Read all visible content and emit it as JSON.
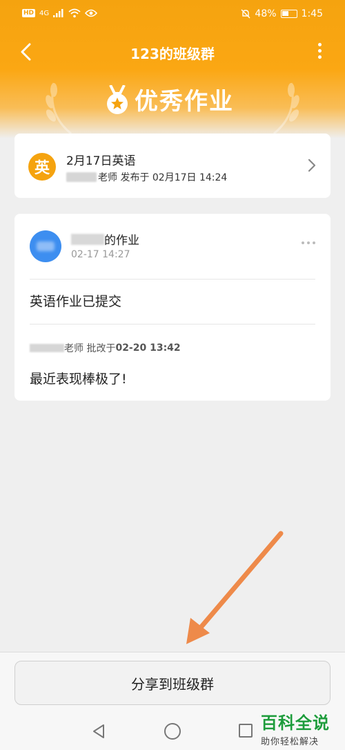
{
  "status_bar": {
    "hd_label": "HD",
    "network_label": "4G",
    "battery_text": "48%",
    "time": "1:45"
  },
  "nav": {
    "title": "123的班级群"
  },
  "banner": {
    "title": "优秀作业"
  },
  "homework_card": {
    "subject_badge": "英",
    "title": "2月17日英语",
    "meta_suffix": "老师 发布于 02月17日 14:24"
  },
  "submission_card": {
    "title_suffix": "的作业",
    "time": "02-17 14:27",
    "content": "英语作业已提交",
    "review_meta_label": "老师 批改于",
    "review_time": "02-20 13:42",
    "review_text": "最近表现棒极了!"
  },
  "bottom": {
    "share_label": "分享到班级群"
  },
  "watermark": {
    "title": "百科全说",
    "subtitle": "助你轻松解决"
  },
  "colors": {
    "accent": "#f5a30f",
    "avatar_blue": "#3d8ef0",
    "arrow": "#ee8a4a",
    "watermark_green": "#1e9c3c"
  }
}
